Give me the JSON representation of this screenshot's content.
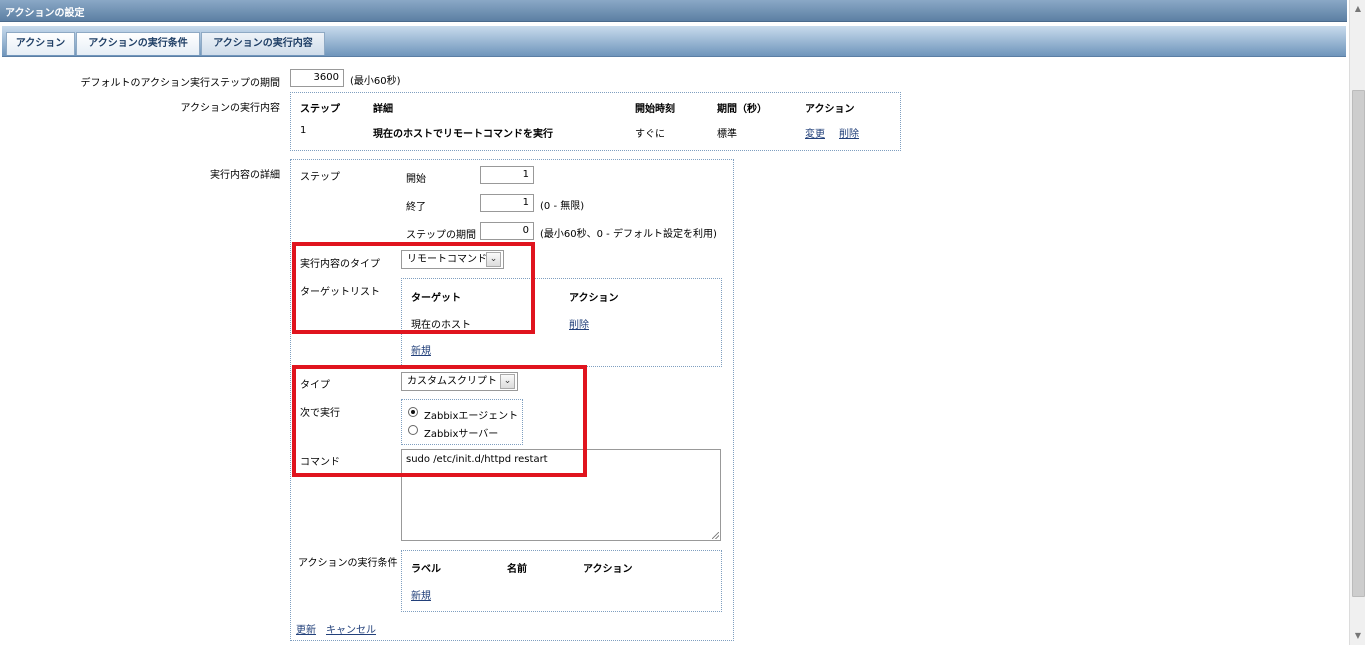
{
  "window": {
    "title": "アクションの設定"
  },
  "tabs": [
    {
      "label": "アクション",
      "active": false
    },
    {
      "label": "アクションの実行条件",
      "active": false
    },
    {
      "label": "アクションの実行内容",
      "active": true
    }
  ],
  "default_step": {
    "label": "デフォルトのアクション実行ステップの期間",
    "value": "3600",
    "hint": "(最小60秒)"
  },
  "operations": {
    "label": "アクションの実行内容",
    "headers": [
      "ステップ",
      "詳細",
      "開始時刻",
      "期間（秒）",
      "アクション"
    ],
    "rows": [
      {
        "step": "1",
        "detail": "現在のホストでリモートコマンドを実行",
        "start": "すぐに",
        "duration": "標準",
        "edit": "変更",
        "delete": "削除"
      }
    ]
  },
  "details": {
    "label": "実行内容の詳細",
    "step_label": "ステップ",
    "from_label": "開始",
    "from_value": "1",
    "to_label": "終了",
    "to_value": "1",
    "to_hint": "(0 - 無限)",
    "duration_label": "ステップの期間",
    "duration_value": "0",
    "duration_hint": "(最小60秒、0 - デフォルト設定を利用)",
    "op_type_label": "実行内容のタイプ",
    "op_type_value": "リモートコマンド",
    "target_list_label": "ターゲットリスト",
    "target_headers": [
      "ターゲット",
      "アクション"
    ],
    "target_rows": [
      {
        "target": "現在のホスト",
        "action": "削除"
      }
    ],
    "target_new": "新規",
    "type_label": "タイプ",
    "type_value": "カスタムスクリプト",
    "execute_on_label": "次で実行",
    "execute_on_options": [
      {
        "label": "Zabbixエージェント",
        "checked": true
      },
      {
        "label": "Zabbixサーバー",
        "checked": false
      }
    ],
    "command_label": "コマンド",
    "command_value": "sudo /etc/init.d/httpd restart",
    "conditions_label": "アクションの実行条件",
    "condition_headers": [
      "ラベル",
      "名前",
      "アクション"
    ],
    "condition_new": "新規",
    "update": "更新",
    "cancel": "キャンセル"
  },
  "colors": {
    "highlight": "#e0141e",
    "tab_text": "#1f3f66",
    "link": "#22407a"
  }
}
